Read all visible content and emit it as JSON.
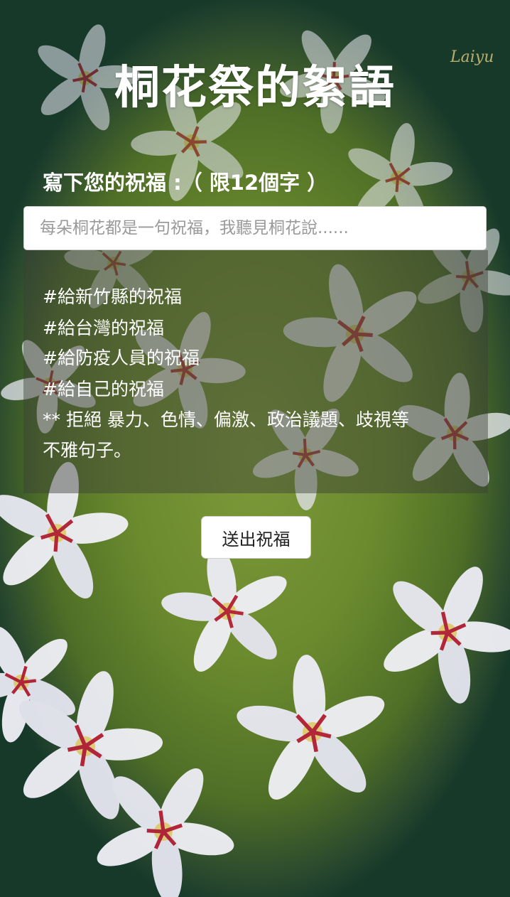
{
  "page": {
    "title": "桐花祭的絮語",
    "signature": "Laiyu"
  },
  "form": {
    "prompt_label": "寫下您的祝福 :（ 限12個字 ）",
    "input_placeholder": "每朵桐花都是一句祝福，我聽見桐花說......",
    "input_value": "",
    "submit_label": "送出祝福"
  },
  "guide": {
    "lines": [
      "#給新竹縣的祝福",
      "#給台灣的祝福",
      "#給防疫人員的祝福",
      "#給自己的祝福",
      "** 拒絕 暴力、色情、偏激、政治議題、歧視等",
      "不雅句子。"
    ]
  },
  "colors": {
    "background_dark": "#17392a",
    "meadow_green": "#6b8a2e",
    "blossom_white": "#f1f1f7",
    "blossom_center": "#b8243a"
  }
}
